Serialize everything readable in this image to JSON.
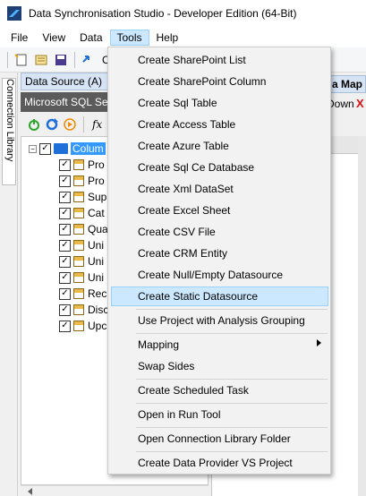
{
  "window": {
    "title": "Data Synchronisation Studio - Developer Edition (64-Bit)"
  },
  "menubar": {
    "items": [
      {
        "label": "File"
      },
      {
        "label": "View"
      },
      {
        "label": "Data"
      },
      {
        "label": "Tools"
      },
      {
        "label": "Help"
      }
    ]
  },
  "toolbar": {
    "partial_label": "Co"
  },
  "side_tab": {
    "label": "Connection Library"
  },
  "data_source": {
    "header": "Data Source (A)",
    "provider": "Microsoft SQL Ser",
    "root_label": "Colum",
    "children": [
      "Pro",
      "Pro",
      "Sup",
      "Cat",
      "Qua",
      "Uni",
      "Uni",
      "Uni",
      "Rec",
      "Disc",
      "Upc"
    ]
  },
  "right_panel": {
    "tab_label": "a Map",
    "down_label": "Down",
    "x_glyph": "X"
  },
  "tools_menu": {
    "group1": [
      "Create SharePoint List",
      "Create SharePoint Column",
      "Create Sql Table",
      "Create Access Table",
      "Create Azure Table",
      "Create Sql Ce Database",
      "Create Xml DataSet",
      "Create Excel Sheet",
      "Create CSV File",
      "Create CRM Entity",
      "Create Null/Empty Datasource",
      "Create Static Datasource"
    ],
    "selected": "Create Static Datasource",
    "analysis": "Use Project with Analysis Grouping",
    "mapping": "Mapping",
    "swap": "Swap Sides",
    "scheduled": "Create Scheduled Task",
    "run_tool": "Open in Run Tool",
    "library": "Open Connection Library Folder",
    "vs_project": "Create Data Provider VS Project"
  },
  "colors": {
    "accent": "#3399ff",
    "menu_highlight": "#cce8ff",
    "provider_bar": "#5b5b5b"
  }
}
